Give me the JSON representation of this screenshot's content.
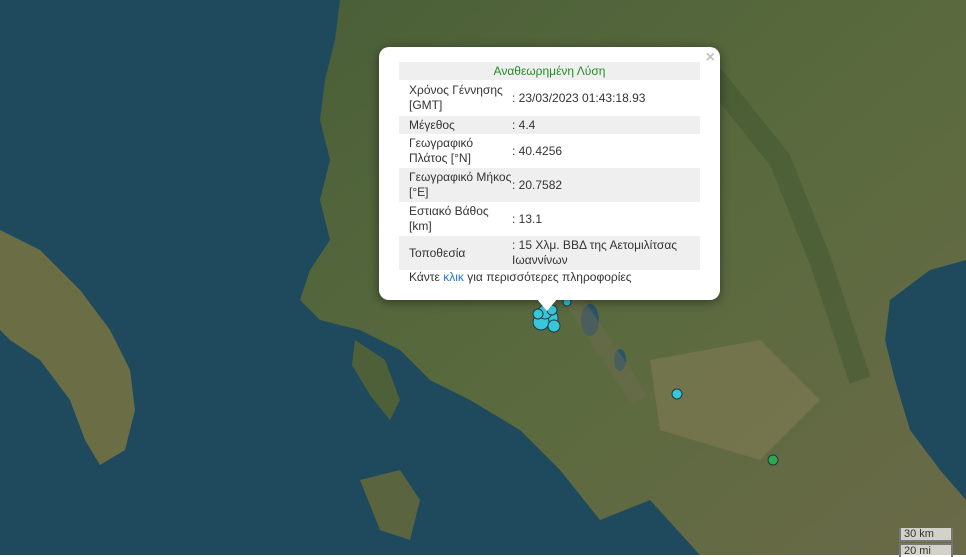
{
  "popup": {
    "title": "Αναθεωρημένη Λύση",
    "rows": [
      {
        "label": "Χρόνος Γέννησης [GMT]",
        "value": ": 23/03/2023 01:43:18.93"
      },
      {
        "label": "Μέγεθος",
        "value": ": 4.4"
      },
      {
        "label": "Γεωγραφικό Πλάτος [°N]",
        "value": ": 40.4256"
      },
      {
        "label": "Γεωγραφικό Μήκος [°E]",
        "value": ": 20.7582"
      },
      {
        "label": "Εστιακό Βάθος [km]",
        "value": ": 13.1"
      },
      {
        "label": "Τοποθεσία",
        "value": ": 15 Χλμ. ΒΒΔ της Αετομιλίτσας Ιωαννίνων"
      }
    ],
    "more_prefix": "Κάντε",
    "more_link": "κλικ",
    "more_suffix": "για περισσότερες πληροφορίες",
    "close": "×"
  },
  "scale": {
    "km": "30 km",
    "mi": "20 mi"
  },
  "colors": {
    "quake_recent": "#39c6d8",
    "quake_older": "#2fa84f",
    "popup_title": "#238b26",
    "link": "#2a78c6"
  }
}
